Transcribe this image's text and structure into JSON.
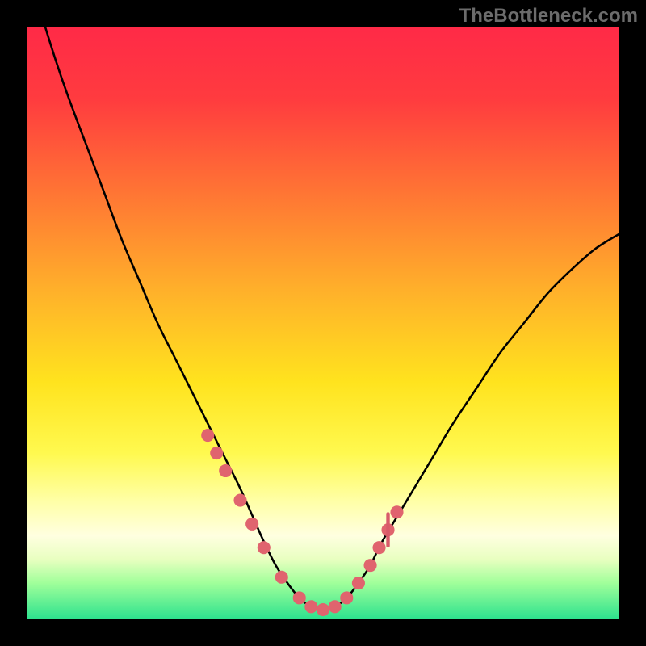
{
  "watermark": "TheBottleneck.com",
  "colors": {
    "background": "#000000",
    "gradient_stops": [
      {
        "offset": 0.0,
        "color": "#ff2a47"
      },
      {
        "offset": 0.12,
        "color": "#ff3b3f"
      },
      {
        "offset": 0.28,
        "color": "#ff7534"
      },
      {
        "offset": 0.45,
        "color": "#ffb22a"
      },
      {
        "offset": 0.6,
        "color": "#ffe31e"
      },
      {
        "offset": 0.72,
        "color": "#fff94f"
      },
      {
        "offset": 0.8,
        "color": "#ffffa5"
      },
      {
        "offset": 0.86,
        "color": "#ffffe0"
      },
      {
        "offset": 0.9,
        "color": "#e8ffc0"
      },
      {
        "offset": 0.94,
        "color": "#a0ff9a"
      },
      {
        "offset": 1.0,
        "color": "#2ee28e"
      }
    ],
    "curve": "#000000",
    "marker": "#e0646e",
    "marker_v": "#d85a6a"
  },
  "chart_data": {
    "type": "line",
    "title": "",
    "xlabel": "",
    "ylabel": "",
    "xlim": [
      0,
      100
    ],
    "ylim": [
      0,
      100
    ],
    "series": [
      {
        "name": "bottleneck-curve",
        "x": [
          0.0,
          3.5,
          7,
          10,
          13,
          16,
          19,
          22,
          25,
          28,
          31,
          33.5,
          36,
          38,
          40,
          42,
          44,
          46,
          48,
          50,
          52,
          54,
          56,
          58,
          60,
          63,
          66,
          69,
          72,
          76,
          80,
          84,
          88,
          92,
          96,
          100
        ],
        "y": [
          110,
          98,
          88,
          80,
          72,
          64,
          57,
          50,
          44,
          38,
          32,
          27,
          22,
          17.5,
          13,
          9,
          6,
          3.5,
          2,
          1.5,
          2,
          3.5,
          6,
          9,
          13,
          18,
          23,
          28,
          33,
          39,
          45,
          50,
          55,
          59,
          62.5,
          65
        ]
      }
    ],
    "markers": {
      "name": "highlight-dots",
      "x": [
        30.5,
        32,
        33.5,
        36,
        38,
        40,
        43,
        46,
        48,
        50,
        52,
        54,
        56,
        58,
        59.5,
        61,
        62.5
      ],
      "y": [
        31,
        28,
        25,
        20,
        16,
        12,
        7,
        3.5,
        2,
        1.5,
        2,
        3.5,
        6,
        9,
        12,
        15,
        18
      ]
    },
    "vertical_tick": {
      "x": 61,
      "y": 15,
      "height": 6
    }
  }
}
